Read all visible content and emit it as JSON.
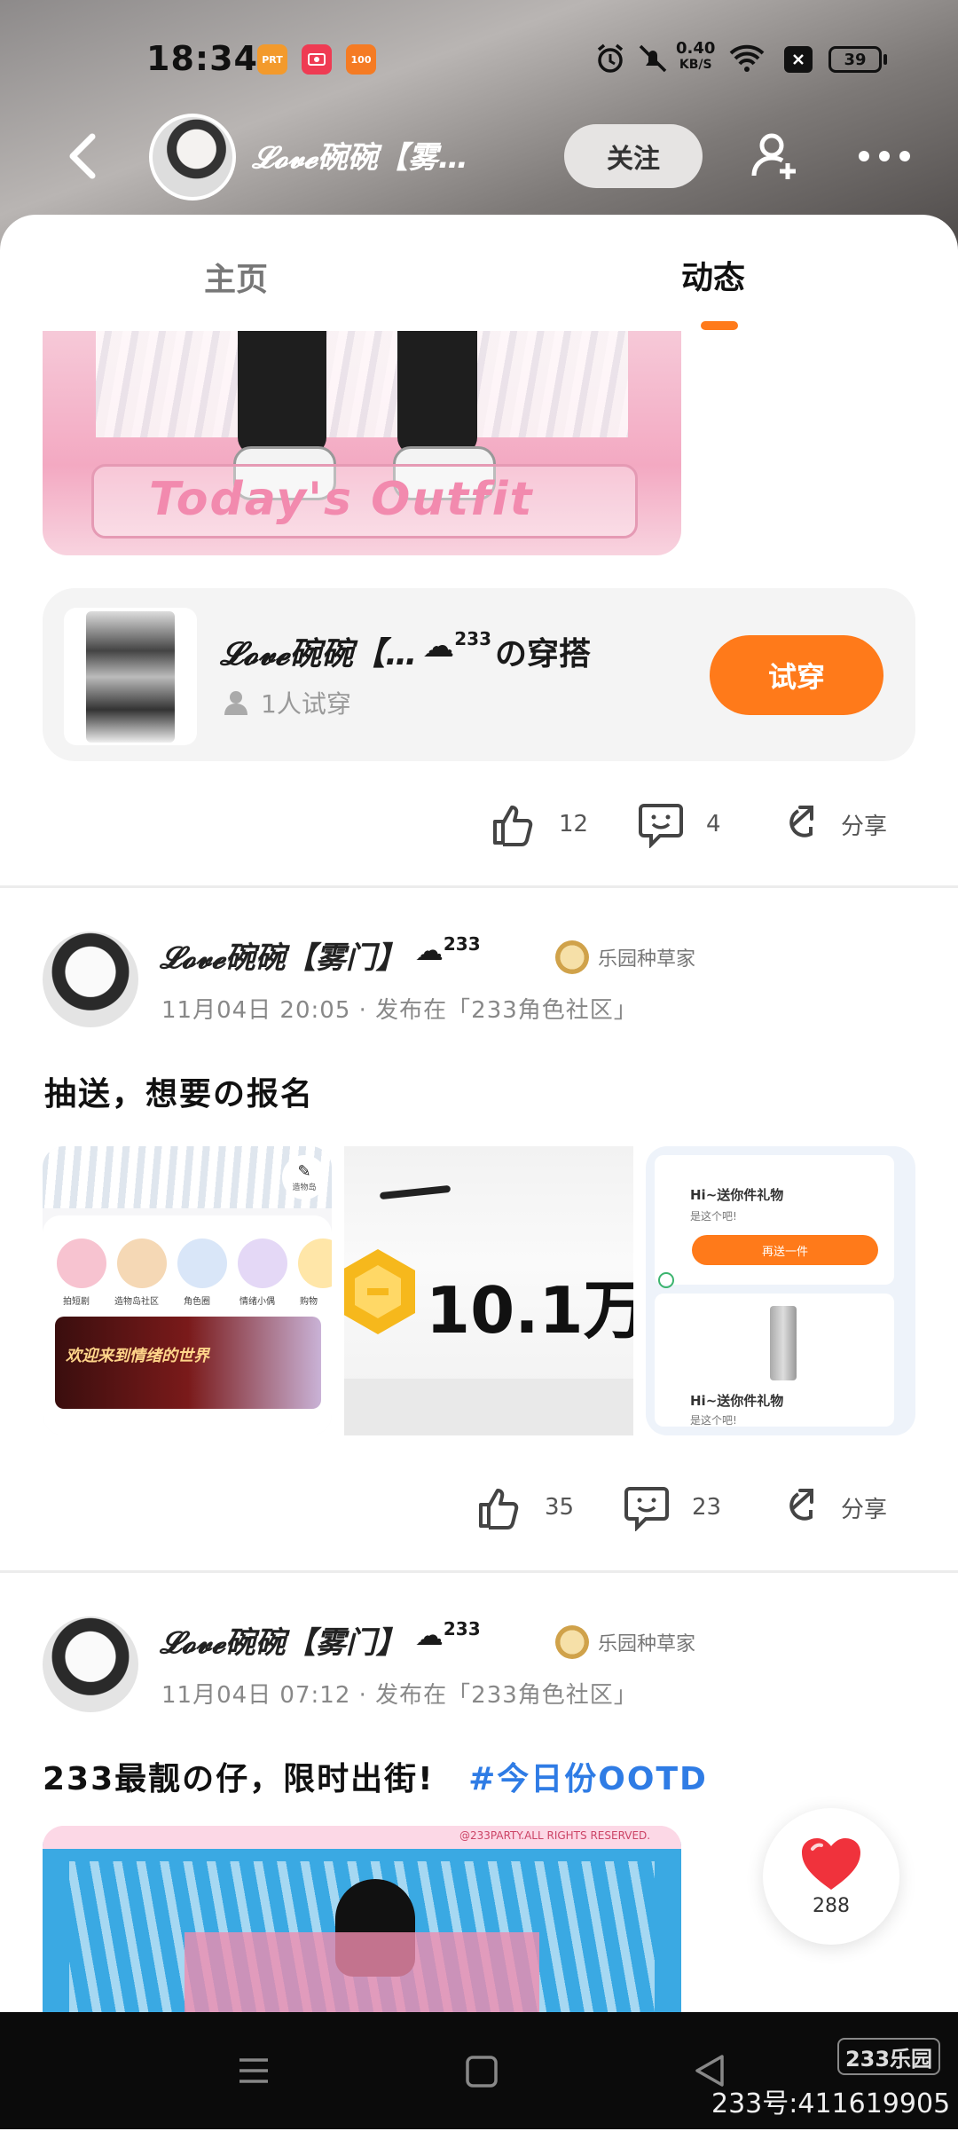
{
  "status_bar": {
    "time": "18:34",
    "net_speed_value": "0.40",
    "net_speed_unit": "KB/S",
    "battery": "39",
    "app_icon_labels": [
      "PRT",
      "",
      "100"
    ]
  },
  "top_bar": {
    "title": "𝓛𝓸𝓿𝓮碗碗【雾…",
    "follow_label": "关注"
  },
  "tabs": [
    {
      "label": "主页",
      "active": false
    },
    {
      "label": "动态",
      "active": true
    }
  ],
  "post1": {
    "image_caption": "Today's Outfit",
    "outfit_card": {
      "title": "𝓛𝓸𝓿𝓮碗碗【…",
      "level": "233",
      "suffix": "の穿搭",
      "tryon_count": "1人试穿",
      "tryon_label": "试穿"
    },
    "likes": "12",
    "comments": "4",
    "share_label": "分享"
  },
  "post2": {
    "username": "𝓛𝓸𝓿𝓮碗碗【雾门】",
    "level": "233",
    "badge": "乐园种草家",
    "time": "11月04日 20:05",
    "published_in": "发布在「233角色社区」",
    "text": "抽送，想要の报名",
    "image1": {
      "corner_label": "造物岛",
      "circles": [
        "拍短剧",
        "造物岛社区",
        "角色圈",
        "情绪小偶",
        "购物"
      ],
      "banner_text": "欢迎来到情绪的世界"
    },
    "image2": {
      "amount": "10.1万"
    },
    "image3": {
      "title1": "Hi~送你件礼物",
      "sub1": "是这个吧!",
      "button": "再送一件",
      "title2": "Hi~送你件礼物",
      "sub2": "是这个吧!"
    },
    "likes": "35",
    "comments": "23",
    "share_label": "分享"
  },
  "post3": {
    "username": "𝓛𝓸𝓿𝓮碗碗【雾门】",
    "level": "233",
    "badge": "乐园种草家",
    "time": "11月04日 07:12",
    "published_in": "发布在「233角色社区」",
    "text": "233最靓の仔，限时出街!",
    "hashtag": "#今日份OOTD",
    "image_caption": "@233PARTY.ALL RIGHTS RESERVED."
  },
  "heart_button": {
    "count": "288"
  },
  "watermark": {
    "logo": "233乐园",
    "id_text": "233号:411619905"
  },
  "colors": {
    "accent": "#ff7a1a",
    "hashtag": "#2f7ce5",
    "heart": "#f0323c"
  }
}
